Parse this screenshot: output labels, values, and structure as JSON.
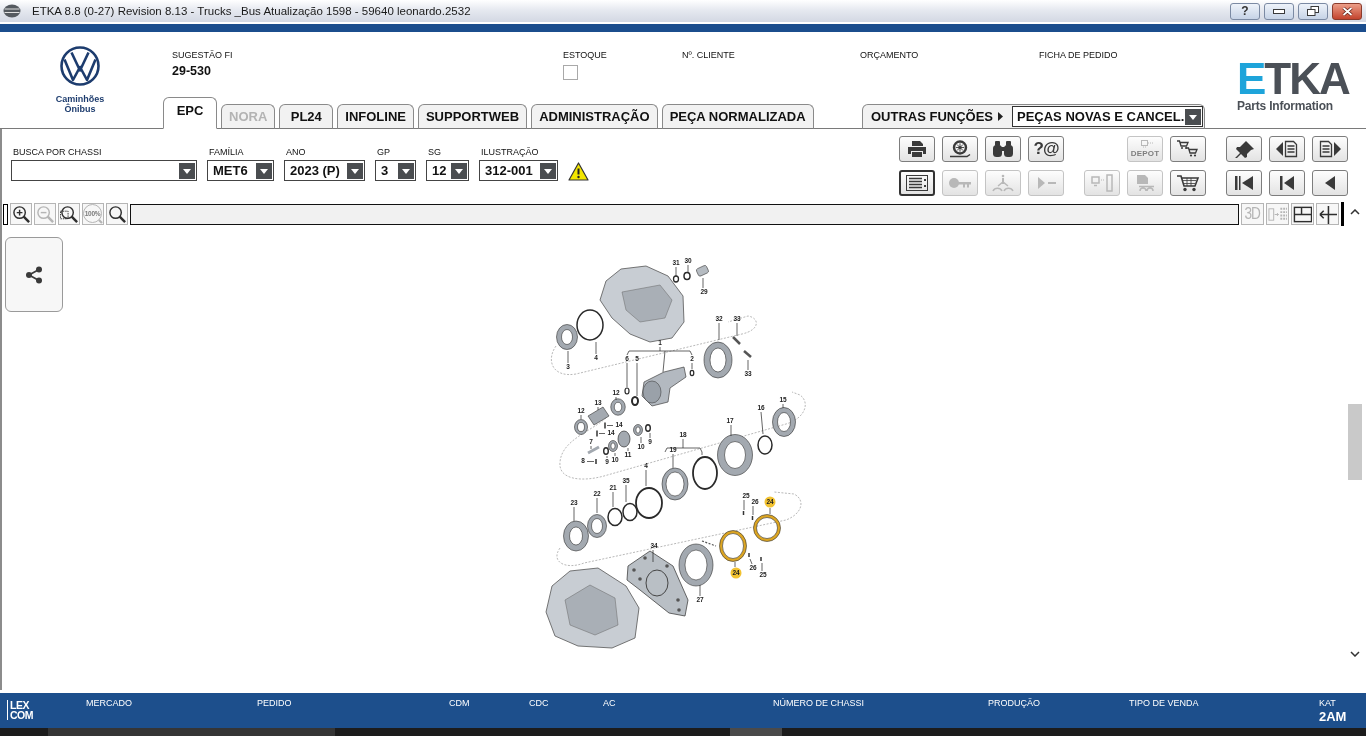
{
  "window": {
    "title": "ETKA 8.8 (0-27) Revision 8.13 - Trucks _Bus Atualização 1598 - 59640 leonardo.2532",
    "controls": [
      {
        "kind": "help",
        "label": "?"
      },
      {
        "kind": "minimize"
      },
      {
        "kind": "restore"
      },
      {
        "kind": "close"
      }
    ]
  },
  "header": {
    "brand_caption": [
      "Caminhões",
      "Ônibus"
    ],
    "fields": [
      {
        "kind": "text",
        "label": "SUGESTÃO FI",
        "value": "29-530"
      },
      {
        "kind": "checkbox",
        "label": "ESTOQUE",
        "checked": false
      },
      {
        "kind": "text",
        "label": "Nº. CLIENTE"
      },
      {
        "kind": "text",
        "label": "ORÇAMENTO"
      },
      {
        "kind": "text",
        "label": "FICHA DE PEDIDO"
      }
    ],
    "logo": {
      "mark": "ETKA",
      "tagline": "Parts Information"
    }
  },
  "tabs": [
    {
      "label": "EPC",
      "selected": true,
      "disabled": false
    },
    {
      "label": "NORA",
      "selected": false,
      "disabled": true
    },
    {
      "label": "PL24",
      "selected": false,
      "disabled": false
    },
    {
      "label": "INFOLINE",
      "selected": false,
      "disabled": false
    },
    {
      "label": "SUPPORTWEB",
      "selected": false,
      "disabled": false
    },
    {
      "label": "ADMINISTRAÇÃO",
      "selected": false,
      "disabled": false
    },
    {
      "label": "PEÇA NORMALIZADA",
      "selected": false,
      "disabled": false
    }
  ],
  "other_functions": {
    "label": "OUTRAS FUNÇÕES",
    "value": "PEÇAS NOVAS E CANCEL."
  },
  "filters": [
    {
      "label": "BUSCA POR CHASSI"
    },
    {
      "label": "FAMÍLIA",
      "value": "MET6"
    },
    {
      "label": "ANO",
      "value": "2023 (P)"
    },
    {
      "label": "GP",
      "value": "3"
    },
    {
      "label": "SG",
      "value": "12"
    },
    {
      "label": "ILUSTRAÇÃO",
      "value": "312-001"
    }
  ],
  "toolbar": {
    "groups": [
      {
        "rows": [
          [
            {
              "kind": "print",
              "disabled": false,
              "selected": false
            },
            {
              "kind": "wheel",
              "disabled": false,
              "selected": false
            },
            {
              "kind": "binoculars",
              "disabled": false,
              "selected": false
            },
            {
              "kind": "contact",
              "label": "?@",
              "disabled": false,
              "selected": false
            }
          ],
          [
            {
              "kind": "list",
              "disabled": false,
              "selected": true
            },
            {
              "kind": "key",
              "disabled": true,
              "selected": false
            },
            {
              "kind": "vehicle-info",
              "disabled": true,
              "selected": false
            },
            {
              "kind": "play",
              "disabled": true,
              "selected": false
            }
          ]
        ]
      },
      {
        "rows": [
          [
            {
              "kind": "depot",
              "label": "DEPOT",
              "disabled": true,
              "selected": false
            },
            {
              "kind": "cart-transfer",
              "disabled": false,
              "selected": false
            }
          ],
          [
            {
              "kind": "terminal",
              "disabled": true,
              "selected": false
            },
            {
              "kind": "doc-vehicle",
              "disabled": true,
              "selected": false
            },
            {
              "kind": "cart",
              "disabled": false,
              "selected": false
            }
          ]
        ]
      },
      {
        "rows": [
          [
            {
              "kind": "pin",
              "disabled": false,
              "selected": false
            },
            {
              "kind": "doc-prev",
              "disabled": false,
              "selected": false
            },
            {
              "kind": "doc-next",
              "disabled": false,
              "selected": false
            }
          ],
          [
            {
              "kind": "first",
              "disabled": false,
              "selected": false
            },
            {
              "kind": "start",
              "disabled": false,
              "selected": false
            },
            {
              "kind": "prev",
              "disabled": false,
              "selected": false
            }
          ]
        ]
      }
    ]
  },
  "zoom_tools": [
    {
      "kind": "zoom-in",
      "disabled": false
    },
    {
      "kind": "zoom-out",
      "disabled": true
    },
    {
      "kind": "zoom-area",
      "disabled": false
    },
    {
      "kind": "zoom-100",
      "label": "100%",
      "disabled": true
    },
    {
      "kind": "magnifier",
      "disabled": false
    }
  ],
  "view_tools": [
    {
      "kind": "model",
      "label": "3D",
      "disabled": true
    },
    {
      "kind": "export",
      "disabled": true
    },
    {
      "kind": "layout",
      "disabled": false
    },
    {
      "kind": "split",
      "disabled": false
    }
  ],
  "diagram": {
    "callouts": [
      {
        "label": "31",
        "highlighted": false
      },
      {
        "label": "30",
        "highlighted": false
      },
      {
        "label": "29",
        "highlighted": false
      },
      {
        "label": "32",
        "highlighted": false
      },
      {
        "label": "33",
        "highlighted": false
      },
      {
        "label": "1",
        "highlighted": false
      },
      {
        "label": "3",
        "highlighted": false
      },
      {
        "label": "4",
        "highlighted": false
      },
      {
        "label": "6",
        "highlighted": false
      },
      {
        "label": "5",
        "highlighted": false
      },
      {
        "label": "2",
        "highlighted": false
      },
      {
        "label": "33",
        "highlighted": false
      },
      {
        "label": "12",
        "highlighted": false
      },
      {
        "label": "13",
        "highlighted": false
      },
      {
        "label": "12",
        "highlighted": false
      },
      {
        "label": "14",
        "highlighted": false
      },
      {
        "label": "14",
        "highlighted": false
      },
      {
        "label": "7",
        "highlighted": false
      },
      {
        "label": "8",
        "highlighted": false
      },
      {
        "label": "9",
        "highlighted": false
      },
      {
        "label": "10",
        "highlighted": false
      },
      {
        "label": "11",
        "highlighted": false
      },
      {
        "label": "10",
        "highlighted": false
      },
      {
        "label": "9",
        "highlighted": false
      },
      {
        "label": "17",
        "highlighted": false
      },
      {
        "label": "16",
        "highlighted": false
      },
      {
        "label": "15",
        "highlighted": false
      },
      {
        "label": "18",
        "highlighted": false
      },
      {
        "label": "19",
        "highlighted": false
      },
      {
        "label": "4",
        "highlighted": false
      },
      {
        "label": "35",
        "highlighted": false
      },
      {
        "label": "21",
        "highlighted": false
      },
      {
        "label": "22",
        "highlighted": false
      },
      {
        "label": "23",
        "highlighted": false
      },
      {
        "label": "25",
        "highlighted": false
      },
      {
        "label": "26",
        "highlighted": false
      },
      {
        "label": "24",
        "highlighted": true
      },
      {
        "label": "24",
        "highlighted": true
      },
      {
        "label": "26",
        "highlighted": false
      },
      {
        "label": "25",
        "highlighted": false
      },
      {
        "label": "34",
        "highlighted": false
      },
      {
        "label": "27",
        "highlighted": false
      }
    ]
  },
  "status_bar": {
    "logo": [
      "LEX",
      "COM"
    ],
    "fields": [
      {
        "label": "MERCADO"
      },
      {
        "label": "PEDIDO"
      },
      {
        "label": "CDM"
      },
      {
        "label": "CDC"
      },
      {
        "label": "AC"
      },
      {
        "label": "NÚMERO DE CHASSI"
      },
      {
        "label": "PRODUÇÃO"
      },
      {
        "label": "TIPO DE VENDA"
      },
      {
        "label": "KAT",
        "value": "2AM"
      }
    ]
  }
}
